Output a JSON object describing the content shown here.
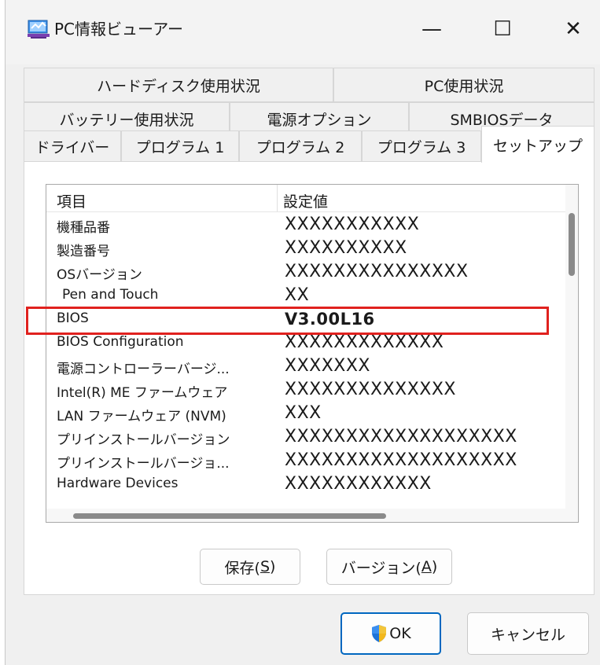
{
  "window": {
    "title": "PC情報ビューアー",
    "minimize_glyph": "—",
    "maximize_glyph": "☐",
    "close_glyph": "✕"
  },
  "tabs": {
    "row1": [
      "ハードディスク使用状況",
      "PC使用状況"
    ],
    "row2": [
      "バッテリー使用状況",
      "電源オプション",
      "SMBIOSデータ"
    ],
    "row3": [
      "ドライバー",
      "プログラム 1",
      "プログラム 2",
      "プログラム 3",
      "セットアップ"
    ],
    "active": "セットアップ"
  },
  "list": {
    "col_item": "項目",
    "col_value": "設定値",
    "rows": [
      {
        "item": "機種品番",
        "value": "XXXXXXXXXXX"
      },
      {
        "item": "製造番号",
        "value": "XXXXXXXXXX"
      },
      {
        "item": "OSバージョン",
        "value": "XXXXXXXXXXXXXXX"
      },
      {
        "item": "Pen and Touch",
        "value": "XX"
      },
      {
        "item": "BIOS",
        "value": "V3.00L16"
      },
      {
        "item": "BIOS Configuration",
        "value": "XXXXXXXXXXXXX"
      },
      {
        "item": "電源コントローラーバージ...",
        "value": "XXXXXXX"
      },
      {
        "item": "Intel(R) ME ファームウェア",
        "value": "XXXXXXXXXXXXXX"
      },
      {
        "item": "LAN ファームウェア (NVM)",
        "value": "XXX"
      },
      {
        "item": "プリインストールバージョン",
        "value": "XXXXXXXXXXXXXXXXXXX"
      },
      {
        "item": "プリインストールバージョ...",
        "value": "XXXXXXXXXXXXXXXXXXX"
      },
      {
        "item": "Hardware Devices",
        "value": "XXXXXXXXXXXX"
      }
    ]
  },
  "buttons": {
    "save_label": "保存(",
    "save_key": "S",
    "save_end": ")",
    "version_label": "バージョン(",
    "version_key": "A",
    "version_end": ")",
    "ok_label": "OK",
    "cancel_label": "キャンセル"
  },
  "colors": {
    "highlight": "#e0211e",
    "ok_border": "#0067c0"
  },
  "icons": {
    "app": "pc-info-icon",
    "shield": "uac-shield-icon"
  }
}
